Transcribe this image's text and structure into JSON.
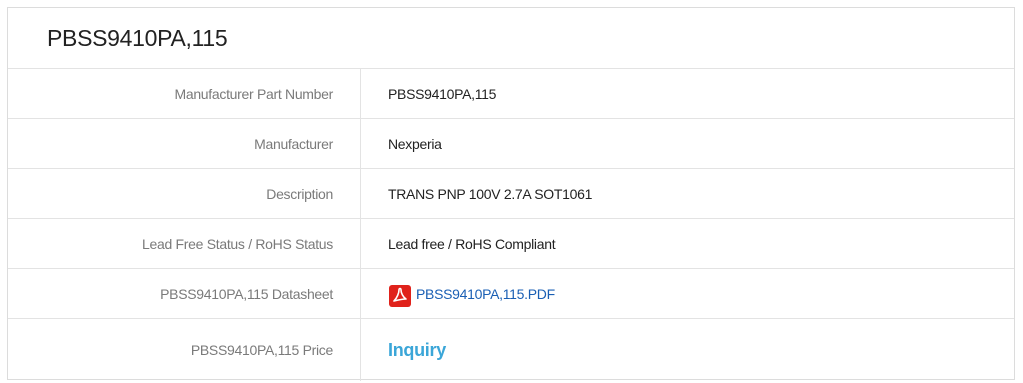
{
  "title": "PBSS9410PA,115",
  "rows": [
    {
      "label": "Manufacturer Part Number",
      "value": "PBSS9410PA,115"
    },
    {
      "label": "Manufacturer",
      "value": "Nexperia"
    },
    {
      "label": "Description",
      "value": "TRANS PNP 100V 2.7A SOT1061"
    },
    {
      "label": "Lead Free Status / RoHS Status",
      "value": "Lead free / RoHS Compliant"
    },
    {
      "label": "PBSS9410PA,115 Datasheet",
      "value": "PBSS9410PA,115.PDF",
      "icon": "pdf-icon"
    },
    {
      "label": "PBSS9410PA,115 Price",
      "value": "Inquiry"
    }
  ],
  "colors": {
    "link": "#1a5fb4",
    "inquiry": "#3ba6d8",
    "pdf_icon": "#e0221b"
  }
}
